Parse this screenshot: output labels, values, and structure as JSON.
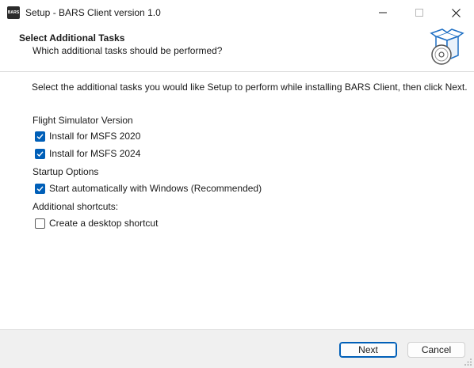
{
  "window": {
    "app_icon_text": "BARS",
    "title": "Setup - BARS Client version 1.0",
    "icons": [
      "minimize-icon",
      "maximize-icon",
      "close-icon"
    ]
  },
  "header": {
    "title": "Select Additional Tasks",
    "subtitle": "Which additional tasks should be performed?",
    "image_icon": "setup-box-cd-icon"
  },
  "main": {
    "instruction": "Select the additional tasks you would like Setup to perform while installing BARS Client, then click Next.",
    "groups": [
      {
        "label": "Flight Simulator Version",
        "options": [
          {
            "label": "Install for MSFS 2020",
            "checked": true
          },
          {
            "label": "Install for MSFS 2024",
            "checked": true
          }
        ]
      },
      {
        "label": "Startup Options",
        "options": [
          {
            "label": "Start automatically with Windows (Recommended)",
            "checked": true
          }
        ]
      },
      {
        "label": "Additional shortcuts:",
        "options": [
          {
            "label": "Create a desktop shortcut",
            "checked": false
          }
        ]
      }
    ]
  },
  "footer": {
    "next_label": "Next",
    "cancel_label": "Cancel"
  },
  "colors": {
    "accent": "#005fb8",
    "background": "#f0f0f0",
    "panel": "#ffffff"
  }
}
